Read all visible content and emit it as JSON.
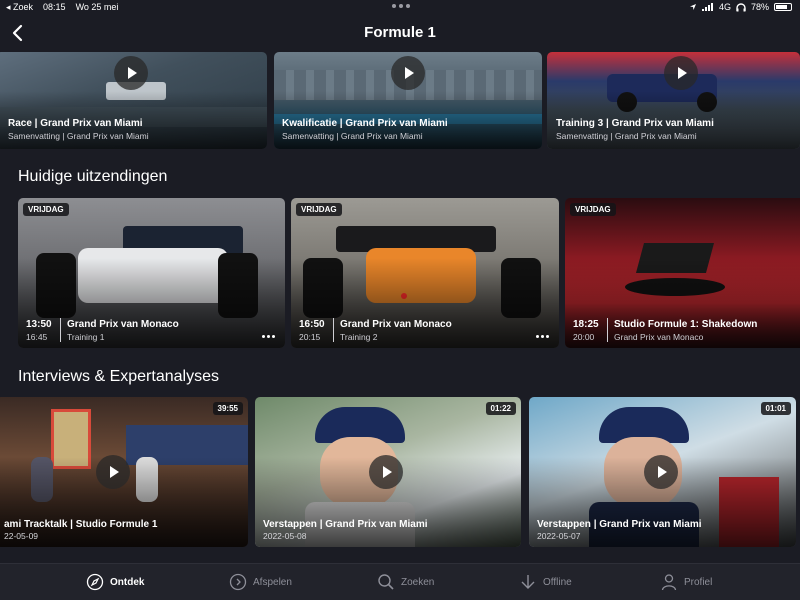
{
  "status": {
    "back_app": "◂ Zoek",
    "time": "08:15",
    "date": "Wo 25 mei",
    "network": "4G",
    "battery": "78%"
  },
  "nav": {
    "title": "Formule 1"
  },
  "top_row": [
    {
      "title": "Race | Grand Prix van Miami",
      "sub": "Samenvatting | Grand Prix van Miami"
    },
    {
      "title": "Kwalificatie | Grand Prix van Miami",
      "sub": "Samenvatting | Grand Prix van Miami"
    },
    {
      "title": "Training 3 | Grand Prix van Miami",
      "sub": "Samenvatting | Grand Prix van Miami"
    }
  ],
  "sections": {
    "current": "Huidige uitzendingen",
    "interviews": "Interviews & Expertanalyses"
  },
  "current": [
    {
      "badge": "VRIJDAG",
      "start": "13:50",
      "end": "16:45",
      "title": "Grand Prix van Monaco",
      "sub": "Training 1"
    },
    {
      "badge": "VRIJDAG",
      "start": "16:50",
      "end": "20:15",
      "title": "Grand Prix van Monaco",
      "sub": "Training 2"
    },
    {
      "badge": "VRIJDAG",
      "start": "18:25",
      "end": "20:00",
      "title": "Studio Formule 1: Shakedown",
      "sub": "Grand Prix van Monaco"
    }
  ],
  "interviews": [
    {
      "duration": "39:55",
      "title": "ami Tracktalk | Studio Formule 1",
      "date": "22-05-09"
    },
    {
      "duration": "01:22",
      "title": "Verstappen | Grand Prix van Miami",
      "date": "2022-05-08"
    },
    {
      "duration": "01:01",
      "title": "Verstappen | Grand Prix van Miami",
      "date": "2022-05-07"
    }
  ],
  "tabs": [
    {
      "label": "Ontdek",
      "icon": "compass-icon",
      "active": true
    },
    {
      "label": "Afspelen",
      "icon": "play-circle-icon"
    },
    {
      "label": "Zoeken",
      "icon": "search-icon"
    },
    {
      "label": "Offline",
      "icon": "download-arrow-icon"
    },
    {
      "label": "Profiel",
      "icon": "person-icon"
    }
  ]
}
